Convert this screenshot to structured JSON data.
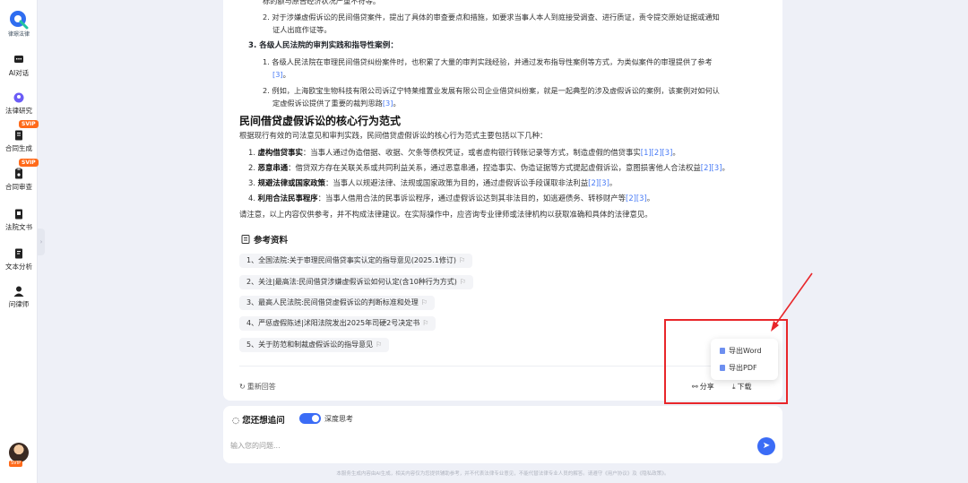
{
  "sidebar": {
    "logo_text": "律璟法律",
    "items": [
      {
        "label": "AI对话",
        "icon": "chat-icon"
      },
      {
        "label": "法律研究",
        "icon": "research-icon"
      },
      {
        "label": "合同生成",
        "icon": "contract-generate-icon",
        "badge": "SVIP"
      },
      {
        "label": "合同审查",
        "icon": "contract-review-icon",
        "badge": "SVIP"
      },
      {
        "label": "法院文书",
        "icon": "court-doc-icon"
      },
      {
        "label": "文本分析",
        "icon": "text-analysis-icon"
      },
      {
        "label": "问律师",
        "icon": "lawyer-icon"
      }
    ],
    "avatar_badge": "SVIP"
  },
  "answer": {
    "top_line": "标的额与原告经济状况严重不符等。",
    "l2_a": "2. 对于涉嫌虚假诉讼的民间借贷案件，提出了具体的审查要点和措施，如要求当事人本人到庭接受调查、进行质证，责令提交原始证据或通知",
    "l2_b": "证人出庭作证等。",
    "sec3_title": "3. 各级人民法院的审判实践和指导性案例：",
    "s3_1a": "1. 各级人民法院在审理民间借贷纠纷案件时，也积累了大量的审判实践经验，并通过发布指导性案例等方式，为类似案件的审理提供了参考",
    "s3_1b": "[3]",
    "s3_1c": "。",
    "s3_2a": "2. 例如，上海欧宝生物科技有限公司诉辽宁特莱维置业发展有限公司企业借贷纠纷案，就是一起典型的涉及虚假诉讼的案例，该案例对如何认",
    "s3_2b": "定虚假诉讼提供了重要的裁判思路",
    "s3_2c": "[3]",
    "s3_2d": "。",
    "heading": "民间借贷虚假诉讼的核心行为范式",
    "intro": "根据现行有效的司法意见和审判实践，民间借贷虚假诉讼的核心行为范式主要包括以下几种：",
    "items": [
      {
        "num": "1.",
        "title": "虚构借贷事实",
        "body": "：当事人通过伪造借据、收据、欠条等债权凭证，或者虚构银行转账记录等方式，制造虚假的借贷事实",
        "cite": "[1][2][3]",
        "end": "。"
      },
      {
        "num": "2.",
        "title": "恶意串通",
        "body": "：借贷双方存在关联关系或共同利益关系，通过恶意串通，捏造事实、伪造证据等方式提起虚假诉讼，意图损害他人合法权益",
        "cite": "[2][3]",
        "end": "。"
      },
      {
        "num": "3.",
        "title": "规避法律或国家政策",
        "body": "：当事人以规避法律、法规或国家政策为目的，通过虚假诉讼手段谋取非法利益",
        "cite": "[2][3]",
        "end": "。"
      },
      {
        "num": "4.",
        "title": "利用合法民事程序",
        "body": "：当事人借用合法的民事诉讼程序，通过虚假诉讼达到其非法目的，如逃避债务、转移财产等",
        "cite": "[2][3]",
        "end": "。"
      }
    ],
    "notice": "请注意，以上内容仅供参考，并不构成法律建议。在实际操作中，应咨询专业律师或法律机构以获取准确和具体的法律意见。"
  },
  "references": {
    "title": "参考资料",
    "items": [
      "1、全国法院:关于审理民间借贷事实认定的指导意见(2025.1修订)",
      "2、关注|最高法:民间借贷涉嫌虚假诉讼如何认定(含10种行为方式)",
      "3、最高人民法院:民间借贷虚假诉讼的判断标准和处理",
      "4、严惩虚假陈述|沭阳法院发出2025年司硬2号决定书",
      "5、关于防范和制裁虚假诉讼的指导意见"
    ]
  },
  "actions": {
    "regenerate": "重新回答",
    "share": "分享",
    "download": "下载",
    "menu": [
      "导出Word",
      "导出PDF"
    ]
  },
  "followup": {
    "title": "您还想追问",
    "toggle_label": "深度思考",
    "placeholder": "输入您的问题..."
  },
  "footer": "本服务生成内容由AI生成，相关内容仅为您提供辅助参考，并不代表法律专业意见，不能代替法律专业人员的解答。请遵守《用户协议》及《隐私政策》。",
  "colors": {
    "accent": "#3b6cf6",
    "highlight": "#e8262a",
    "badge": "#ff6a1a"
  }
}
